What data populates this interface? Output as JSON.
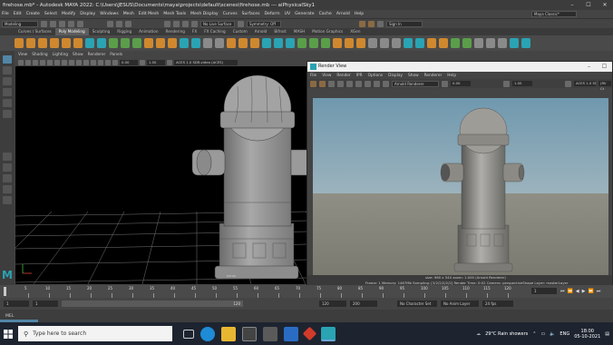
{
  "window": {
    "title": "firehose.mb* - Autodesk MAYA 2022: C:\\Users\\JESUS\\Documents\\maya\\projects\\default\\scenes\\firehose.mb --- aiPhysicalSky1"
  },
  "menubar": {
    "items": [
      "File",
      "Edit",
      "Create",
      "Select",
      "Modify",
      "Display",
      "Windows",
      "Mesh",
      "Edit Mesh",
      "Mesh Tools",
      "Mesh Display",
      "Curves",
      "Surfaces",
      "Deform",
      "UV",
      "Generate",
      "Cache",
      "Arnold",
      "Help"
    ],
    "workspace": "Maya Classic*"
  },
  "statusline": {
    "mode": "Modeling",
    "live_surface": "No Live Surface",
    "symmetry": "Symmetry: Off",
    "signin": "Sign In"
  },
  "shelf": {
    "tabs": [
      "Curves / Surfaces",
      "Poly Modeling",
      "Sculpting",
      "Rigging",
      "Animation",
      "Rendering",
      "FX",
      "FX Caching",
      "Custom",
      "Arnold",
      "Bifrost",
      "MASH",
      "Motion Graphics",
      "XGen"
    ],
    "active_tab": "Poly Modeling"
  },
  "viewport": {
    "menu": [
      "View",
      "Shading",
      "Lighting",
      "Show",
      "Renderer",
      "Panels"
    ],
    "field_a": "0.00",
    "field_b": "1.00",
    "colorspace": "ACES 1.0 SDR-video (ACES)",
    "camera_label": "persp"
  },
  "render_view": {
    "title": "Render View",
    "menu": [
      "File",
      "View",
      "Render",
      "IPR",
      "Options",
      "Display",
      "Show",
      "Renderer",
      "Help"
    ],
    "renderer": "Arnold Renderer",
    "field_a": "0.00",
    "field_b": "1.00",
    "colorspace": "ACES 1.0 SDR-video (ACES)",
    "tab": "(RV Ct",
    "info_line1": "size: 960 x 540 zoom: 1.000      (Arnold Renderer)",
    "info_line2": "Frame: 1      Memory: 1467Mb      Sampling: [3/2/2/2/2/2]      Render Time: 0:02      Camera: perspectiveShape      Layer: masterLayer"
  },
  "timeline": {
    "ticks": [
      "5",
      "10",
      "15",
      "20",
      "25",
      "30",
      "35",
      "40",
      "45",
      "50",
      "55",
      "60",
      "65",
      "70",
      "75",
      "80",
      "85",
      "90",
      "95",
      "100",
      "105",
      "110",
      "115",
      "120"
    ],
    "current_frame": "1",
    "range_start": "1",
    "range_start2": "1",
    "range_end_inner": "120",
    "range_end": "120",
    "range_end2": "200",
    "character_set": "No Character Set",
    "anim_layer": "No Anim Layer",
    "fps": "24 fps"
  },
  "command_line": {
    "label": "MEL"
  },
  "taskbar": {
    "search_placeholder": "Type here to search",
    "weather": "29°C  Rain showers",
    "lang": "ENG",
    "time": "18:00",
    "date": "05-10-2021"
  },
  "colors": {
    "maya_accent": "#5285a6",
    "render_sky": "#7b9fb2",
    "render_ground": "#85857a"
  }
}
